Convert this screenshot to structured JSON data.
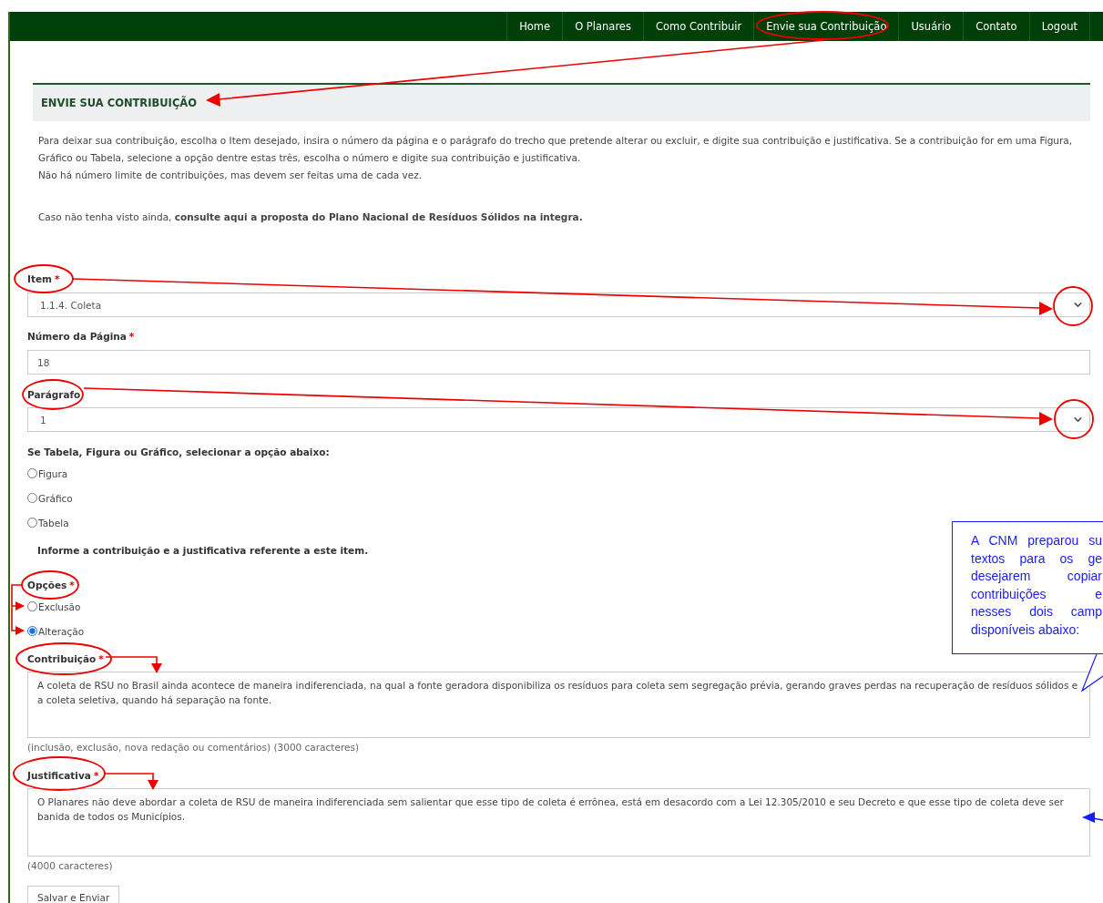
{
  "nav": {
    "items": [
      {
        "label": "Home"
      },
      {
        "label": "O Planares"
      },
      {
        "label": "Como Contribuir"
      },
      {
        "label": "Envie sua Contribuição"
      },
      {
        "label": "Usuário"
      },
      {
        "label": "Contato"
      },
      {
        "label": "Logout"
      }
    ]
  },
  "panel": {
    "title": "ENVIE SUA CONTRIBUIÇÃO"
  },
  "intro": {
    "lines": [
      "Para deixar sua contribuição, escolha o Item desejado, insira o número da página e o parágrafo do trecho que pretende alterar ou excluir, e digite sua contribuição e justificativa. Se a contribuição for em uma Figura, Gráfico ou Tabela, selecione a opção dentre estas três, escolha o número e digite sua contribuição e justificativa.",
      "Não há número limite de contribuições, mas devem ser feitas uma de cada vez."
    ],
    "consult": "Caso não tenha visto ainda, **consulte aqui a proposta do Plano Nacional de Resíduos Sólidos na integra.**"
  },
  "form": {
    "item": {
      "label": "Item",
      "required_mark": "*",
      "value": "1.1.4. Coleta"
    },
    "page": {
      "label": "Número da Página",
      "required_mark": "*",
      "value": "18"
    },
    "paragraph": {
      "label": "Parágrafo",
      "value": "1"
    },
    "type_group": {
      "label": "Se Tabela, Figura ou Gráfico, selecionar a opção abaixo:",
      "options": [
        {
          "label": "Figura",
          "selected": false
        },
        {
          "label": "Gráfico",
          "selected": false
        },
        {
          "label": "Tabela",
          "selected": false
        }
      ]
    },
    "info": "Informe a contribuição e a justificativa referente a este item.",
    "options_group": {
      "label": "Opções",
      "required_mark": "*",
      "options": [
        {
          "label": "Exclusão",
          "selected": false
        },
        {
          "label": "Alteração",
          "selected": true
        }
      ]
    },
    "contribution": {
      "label": "Contribuição",
      "required_mark": "*",
      "value": "A coleta de RSU no Brasil ainda acontece de maneira indiferenciada, na qual a fonte geradora disponibiliza os resíduos para coleta sem segregação prévia, gerando graves perdas na recuperação de resíduos sólidos e a coleta seletiva, quando há separação na fonte.",
      "hint": "(inclusão, exclusão, nova redação ou comentários) (3000 caracteres)"
    },
    "justification": {
      "label": "Justificativa",
      "required_mark": "*",
      "value": "O Planares não deve abordar a coleta de RSU de maneira indiferenciada sem salientar que esse tipo de coleta é errônea, está em desacordo com a Lei 12.305/2010 e seu Decreto e que esse tipo de coleta deve ser banida de todos os Municípios.",
      "hint": "(4000 caracteres)"
    },
    "submit": "Salvar e Enviar"
  },
  "callout": {
    "lines": [
      "A CNM preparou su",
      "textos para os ge",
      "desejarem copiar",
      "contribuições e",
      "nesses dois camp",
      "disponíveis abaixo:"
    ]
  }
}
